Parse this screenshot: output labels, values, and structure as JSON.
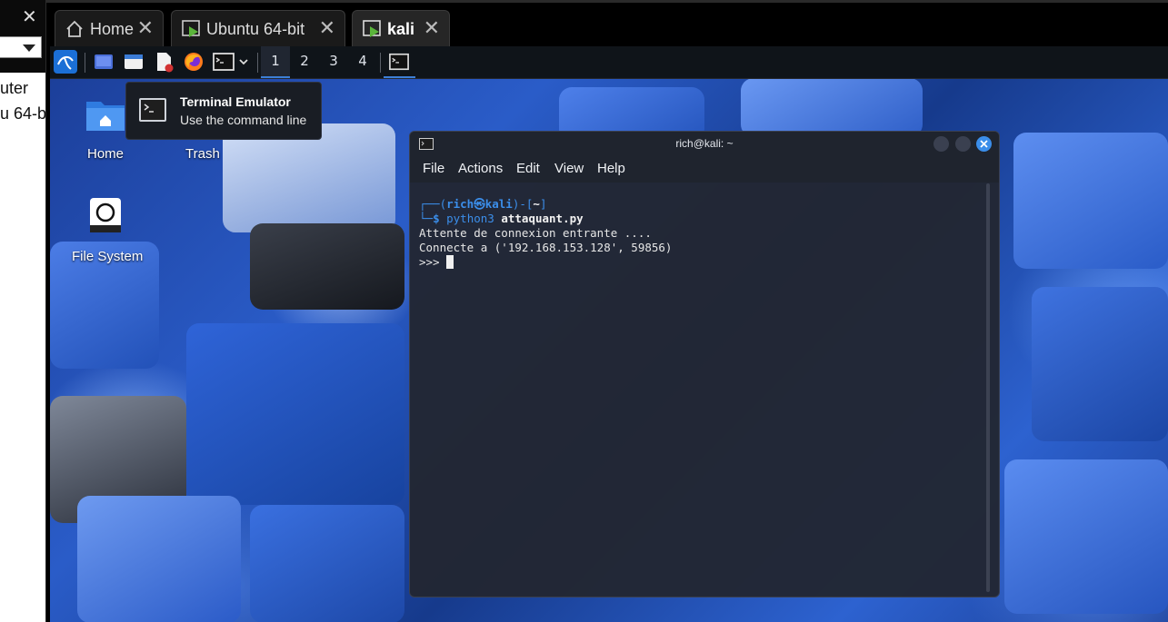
{
  "left_panel": {
    "items": [
      "uter",
      "u 64-b"
    ]
  },
  "tabs": [
    {
      "label": "Home",
      "icon": "home-icon",
      "active": false
    },
    {
      "label": "Ubuntu 64-bit",
      "icon": "vm-icon",
      "active": false
    },
    {
      "label": "kali",
      "icon": "vm-icon",
      "active": true
    }
  ],
  "close_glyph": "✕",
  "panel": {
    "workspaces": [
      "1",
      "2",
      "3",
      "4"
    ],
    "active_workspace": "1",
    "launchers": [
      "kali-menu-icon",
      "show-desktop-icon",
      "file-manager-icon",
      "text-editor-icon",
      "firefox-icon",
      "terminal-icon"
    ]
  },
  "tooltip": {
    "title": "Terminal Emulator",
    "subtitle": "Use the command line"
  },
  "desktop_icons": [
    {
      "label": "Home",
      "icon": "home-folder-icon"
    },
    {
      "label": "Trash",
      "icon": "trash-icon"
    },
    {
      "label": "File System",
      "icon": "drive-icon"
    }
  ],
  "terminal": {
    "title": "rich@kali: ~",
    "menu": [
      "File",
      "Actions",
      "Edit",
      "View",
      "Help"
    ],
    "prompt_user": "rich",
    "prompt_symbol": "㉿",
    "prompt_host": "kali",
    "prompt_dir": "~",
    "command": "python3",
    "command_arg": "attaquant.py",
    "output": [
      "Attente de connexion entrante ....",
      "Connecte a ('192.168.153.128', 59856)"
    ],
    "repl_prompt": ">>> "
  },
  "colors": {
    "accent": "#3b8eea",
    "terminal_bg": "#222732",
    "panel_bg": "#0f1419"
  }
}
